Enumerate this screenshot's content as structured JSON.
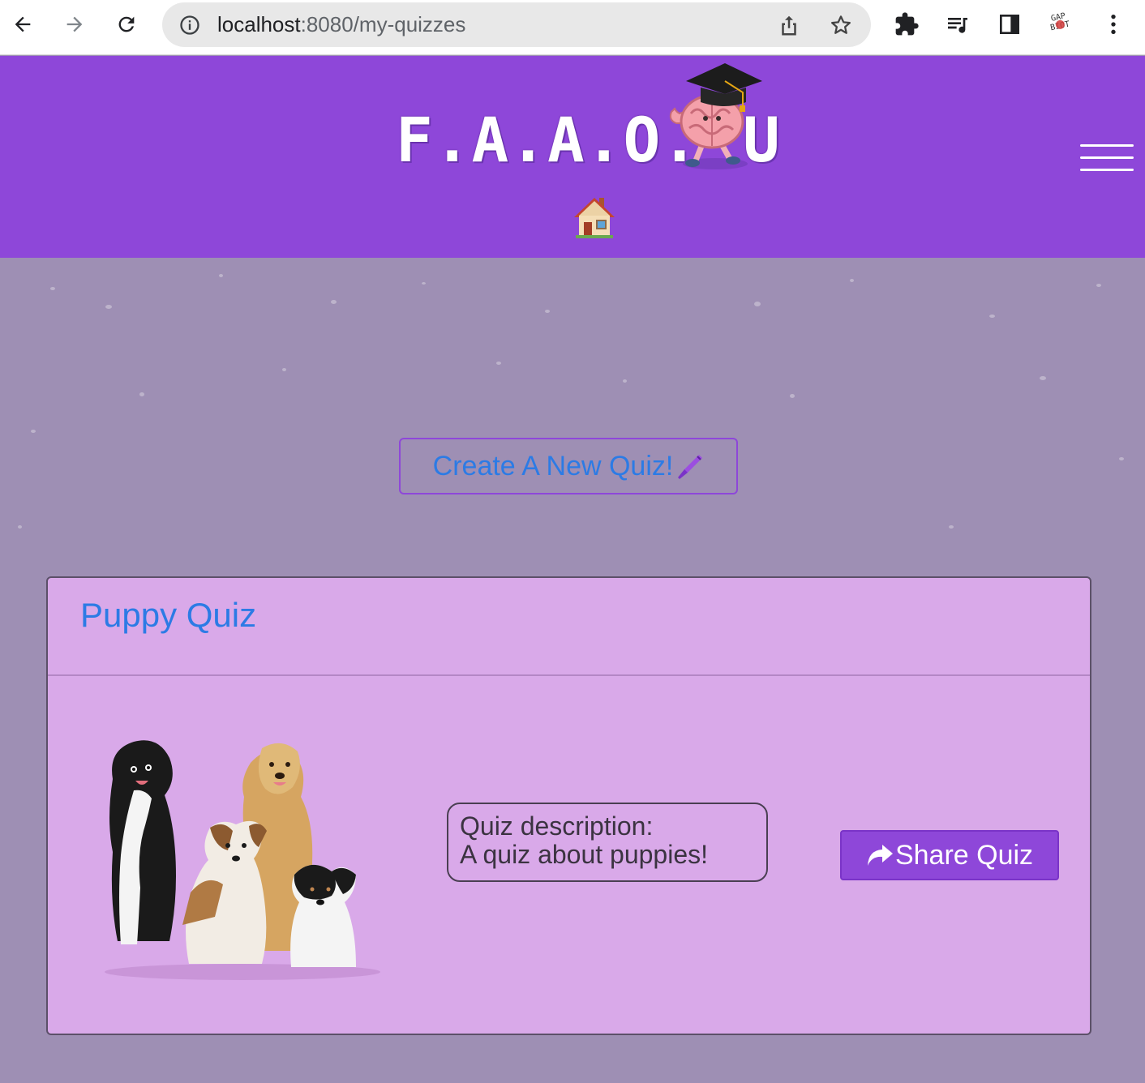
{
  "browser": {
    "url_host": "localhost",
    "url_path": ":8080/my-quizzes"
  },
  "site": {
    "logo_text": "F.A.A.O.",
    "logo_suffix": "U",
    "header_color": "#8e47d9"
  },
  "main": {
    "create_button_label": "Create A New Quiz!"
  },
  "quiz": {
    "title": "Puppy Quiz",
    "description_label": "Quiz description:",
    "description_text": "A quiz about puppies!",
    "share_button_label": "Share Quiz"
  },
  "icons": {
    "back": "arrow-left-icon",
    "forward": "arrow-right-icon",
    "reload": "reload-icon",
    "site_info": "info-icon",
    "share_page": "share-page-icon",
    "bookmark": "star-icon",
    "extensions": "puzzle-icon",
    "media": "media-playlist-icon",
    "side_panel": "side-panel-icon",
    "profile": "gap-bot-icon",
    "menu": "kebab-menu-icon",
    "hamburger": "hamburger-menu-icon",
    "home": "house-icon",
    "pen": "pen-icon",
    "share": "share-arrow-icon"
  }
}
